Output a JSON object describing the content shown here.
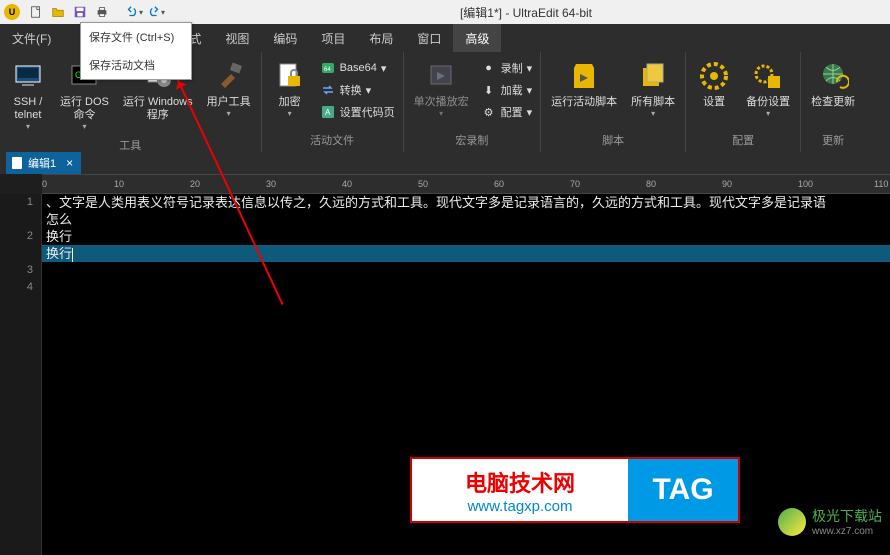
{
  "titlebar": {
    "title": "[编辑1*] - UltraEdit 64-bit",
    "app_icon_letter": "U"
  },
  "qat": {
    "new": "new",
    "open": "open",
    "save": "save",
    "print": "print",
    "undo": "undo",
    "redo": "redo"
  },
  "menubar": {
    "file": "文件(F)",
    "format": "式",
    "view": "视图",
    "encoding": "编码",
    "project": "项目",
    "layout": "布局",
    "window": "窗口",
    "advanced": "高级"
  },
  "dropdown": {
    "save_file": "保存文件 (Ctrl+S)",
    "save_active_doc": "保存活动文档"
  },
  "ribbon": {
    "group_tools": {
      "label": "工具",
      "ssh": "SSH /\ntelnet",
      "run_dos": "运行 DOS\n命令",
      "run_windows": "运行 Windows\n程序",
      "user_tools": "用户工具"
    },
    "group_active_file": {
      "label": "活动文件",
      "encrypt": "加密",
      "base64": "Base64",
      "convert": "转换",
      "set_codepage": "设置代码页"
    },
    "group_macro": {
      "label": "宏录制",
      "play_macro": "单次播放宏",
      "record": "录制",
      "load": "加载",
      "configure": "配置"
    },
    "group_script": {
      "label": "脚本",
      "run_active_script": "运行活动脚本",
      "all_scripts": "所有脚本"
    },
    "group_configuration": {
      "label": "配置",
      "settings": "设置",
      "backup_settings": "备份设置"
    },
    "group_update": {
      "label": "更新",
      "check_update": "检查更新"
    }
  },
  "doc_tab": {
    "label": "编辑1",
    "close": "×"
  },
  "ruler": {
    "t0": "0",
    "t10": "10",
    "t20": "20",
    "t30": "30",
    "t40": "40",
    "t50": "50",
    "t60": "60",
    "t70": "70",
    "t80": "80",
    "t90": "90",
    "t100": "100",
    "t110": "110"
  },
  "editor": {
    "lines": {
      "l1": "1",
      "l2": "",
      "l3": "2",
      "l4": "",
      "l5": "3",
      "l6": "4"
    },
    "content": {
      "c1": "、文字是人类用表义符号记录表达信息以传之，久远的方式和工具。现代文字多是记录语言的，久远的方式和工具。现代文字多是记录语",
      "c2": "怎么",
      "c3": "换行",
      "c4": "换行"
    }
  },
  "watermark1": {
    "title": "电脑技术网",
    "url": "www.tagxp.com",
    "tag": "TAG"
  },
  "watermark2": {
    "name": "极光下载站",
    "url": "www.xz7.com"
  }
}
